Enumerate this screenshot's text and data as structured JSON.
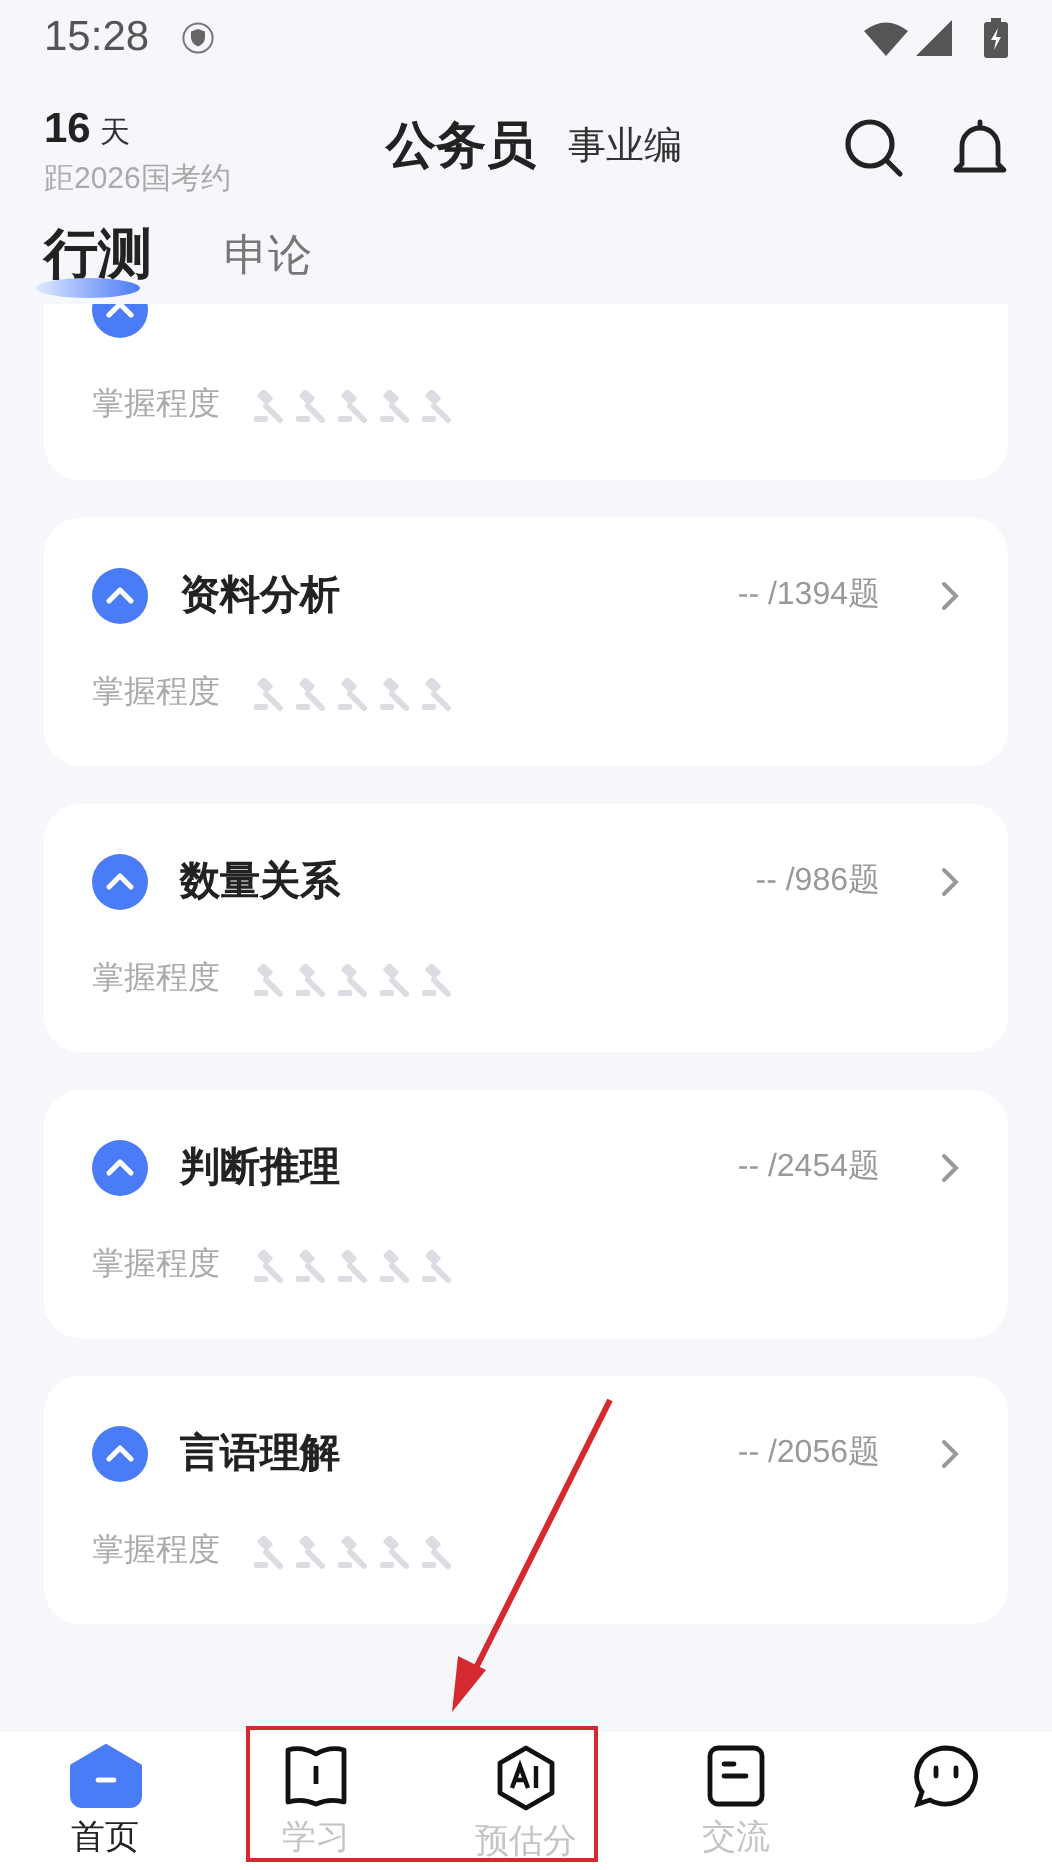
{
  "status_bar": {
    "time": "15:28"
  },
  "header": {
    "days": "16",
    "days_unit": "天",
    "countdown_label": "距2026国考约",
    "exams": [
      {
        "label": "公务员",
        "selected": true
      },
      {
        "label": "事业编",
        "selected": false
      }
    ]
  },
  "tabs": [
    {
      "label": "行测",
      "selected": true
    },
    {
      "label": "申论",
      "selected": false
    }
  ],
  "modules": [
    {
      "kind": "clipped",
      "mastery_label": "掌握程度",
      "stars": 0
    },
    {
      "kind": "full",
      "title": "资料分析",
      "count": "-- /1394题",
      "mastery_label": "掌握程度",
      "stars": 0
    },
    {
      "kind": "full",
      "title": "数量关系",
      "count": "-- /986题",
      "mastery_label": "掌握程度",
      "stars": 0
    },
    {
      "kind": "full",
      "title": "判断推理",
      "count": "-- /2454题",
      "mastery_label": "掌握程度",
      "stars": 0
    },
    {
      "kind": "full",
      "title": "言语理解",
      "count": "-- /2056题",
      "mastery_label": "掌握程度",
      "stars": 0
    }
  ],
  "bottom_nav": [
    {
      "kind": "home",
      "label": "首页",
      "selected": true
    },
    {
      "kind": "study",
      "label": "学习",
      "selected": false
    },
    {
      "kind": "ai",
      "label": "预估分",
      "selected": false
    },
    {
      "kind": "chat",
      "label": "交流",
      "selected": false
    },
    {
      "kind": "face",
      "selected": false
    }
  ],
  "annotation": {
    "color": "#d42a2f"
  }
}
